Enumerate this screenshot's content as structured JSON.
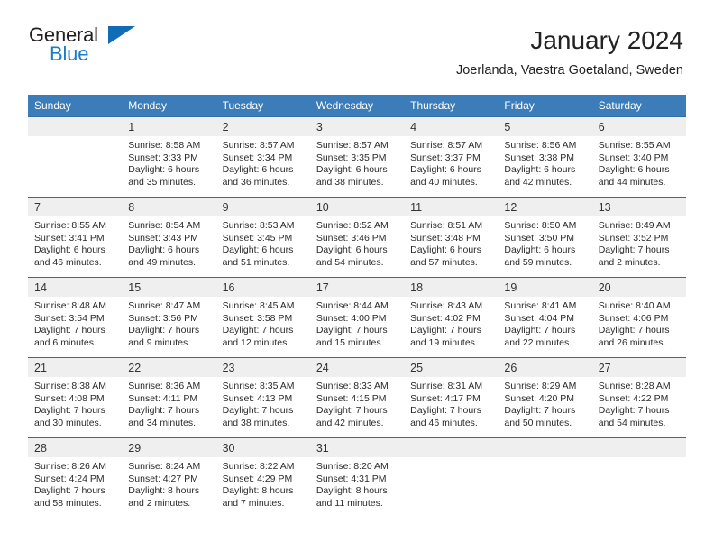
{
  "brand": {
    "name_part1": "General",
    "name_part2": "Blue",
    "accent_color": "#1d7dc4",
    "logo_triangle_color": "#0f6cb5"
  },
  "header": {
    "title": "January 2024",
    "location": "Joerlanda, Vaestra Goetaland, Sweden"
  },
  "calendar": {
    "header_bg": "#3b7cb9",
    "row_border_color": "#2f6da8",
    "daynum_bg": "#efefef",
    "weekday_headers": [
      "Sunday",
      "Monday",
      "Tuesday",
      "Wednesday",
      "Thursday",
      "Friday",
      "Saturday"
    ],
    "weeks": [
      [
        {
          "day": "",
          "lines": []
        },
        {
          "day": "1",
          "lines": [
            "Sunrise: 8:58 AM",
            "Sunset: 3:33 PM",
            "Daylight: 6 hours",
            "and 35 minutes."
          ]
        },
        {
          "day": "2",
          "lines": [
            "Sunrise: 8:57 AM",
            "Sunset: 3:34 PM",
            "Daylight: 6 hours",
            "and 36 minutes."
          ]
        },
        {
          "day": "3",
          "lines": [
            "Sunrise: 8:57 AM",
            "Sunset: 3:35 PM",
            "Daylight: 6 hours",
            "and 38 minutes."
          ]
        },
        {
          "day": "4",
          "lines": [
            "Sunrise: 8:57 AM",
            "Sunset: 3:37 PM",
            "Daylight: 6 hours",
            "and 40 minutes."
          ]
        },
        {
          "day": "5",
          "lines": [
            "Sunrise: 8:56 AM",
            "Sunset: 3:38 PM",
            "Daylight: 6 hours",
            "and 42 minutes."
          ]
        },
        {
          "day": "6",
          "lines": [
            "Sunrise: 8:55 AM",
            "Sunset: 3:40 PM",
            "Daylight: 6 hours",
            "and 44 minutes."
          ]
        }
      ],
      [
        {
          "day": "7",
          "lines": [
            "Sunrise: 8:55 AM",
            "Sunset: 3:41 PM",
            "Daylight: 6 hours",
            "and 46 minutes."
          ]
        },
        {
          "day": "8",
          "lines": [
            "Sunrise: 8:54 AM",
            "Sunset: 3:43 PM",
            "Daylight: 6 hours",
            "and 49 minutes."
          ]
        },
        {
          "day": "9",
          "lines": [
            "Sunrise: 8:53 AM",
            "Sunset: 3:45 PM",
            "Daylight: 6 hours",
            "and 51 minutes."
          ]
        },
        {
          "day": "10",
          "lines": [
            "Sunrise: 8:52 AM",
            "Sunset: 3:46 PM",
            "Daylight: 6 hours",
            "and 54 minutes."
          ]
        },
        {
          "day": "11",
          "lines": [
            "Sunrise: 8:51 AM",
            "Sunset: 3:48 PM",
            "Daylight: 6 hours",
            "and 57 minutes."
          ]
        },
        {
          "day": "12",
          "lines": [
            "Sunrise: 8:50 AM",
            "Sunset: 3:50 PM",
            "Daylight: 6 hours",
            "and 59 minutes."
          ]
        },
        {
          "day": "13",
          "lines": [
            "Sunrise: 8:49 AM",
            "Sunset: 3:52 PM",
            "Daylight: 7 hours",
            "and 2 minutes."
          ]
        }
      ],
      [
        {
          "day": "14",
          "lines": [
            "Sunrise: 8:48 AM",
            "Sunset: 3:54 PM",
            "Daylight: 7 hours",
            "and 6 minutes."
          ]
        },
        {
          "day": "15",
          "lines": [
            "Sunrise: 8:47 AM",
            "Sunset: 3:56 PM",
            "Daylight: 7 hours",
            "and 9 minutes."
          ]
        },
        {
          "day": "16",
          "lines": [
            "Sunrise: 8:45 AM",
            "Sunset: 3:58 PM",
            "Daylight: 7 hours",
            "and 12 minutes."
          ]
        },
        {
          "day": "17",
          "lines": [
            "Sunrise: 8:44 AM",
            "Sunset: 4:00 PM",
            "Daylight: 7 hours",
            "and 15 minutes."
          ]
        },
        {
          "day": "18",
          "lines": [
            "Sunrise: 8:43 AM",
            "Sunset: 4:02 PM",
            "Daylight: 7 hours",
            "and 19 minutes."
          ]
        },
        {
          "day": "19",
          "lines": [
            "Sunrise: 8:41 AM",
            "Sunset: 4:04 PM",
            "Daylight: 7 hours",
            "and 22 minutes."
          ]
        },
        {
          "day": "20",
          "lines": [
            "Sunrise: 8:40 AM",
            "Sunset: 4:06 PM",
            "Daylight: 7 hours",
            "and 26 minutes."
          ]
        }
      ],
      [
        {
          "day": "21",
          "lines": [
            "Sunrise: 8:38 AM",
            "Sunset: 4:08 PM",
            "Daylight: 7 hours",
            "and 30 minutes."
          ]
        },
        {
          "day": "22",
          "lines": [
            "Sunrise: 8:36 AM",
            "Sunset: 4:11 PM",
            "Daylight: 7 hours",
            "and 34 minutes."
          ]
        },
        {
          "day": "23",
          "lines": [
            "Sunrise: 8:35 AM",
            "Sunset: 4:13 PM",
            "Daylight: 7 hours",
            "and 38 minutes."
          ]
        },
        {
          "day": "24",
          "lines": [
            "Sunrise: 8:33 AM",
            "Sunset: 4:15 PM",
            "Daylight: 7 hours",
            "and 42 minutes."
          ]
        },
        {
          "day": "25",
          "lines": [
            "Sunrise: 8:31 AM",
            "Sunset: 4:17 PM",
            "Daylight: 7 hours",
            "and 46 minutes."
          ]
        },
        {
          "day": "26",
          "lines": [
            "Sunrise: 8:29 AM",
            "Sunset: 4:20 PM",
            "Daylight: 7 hours",
            "and 50 minutes."
          ]
        },
        {
          "day": "27",
          "lines": [
            "Sunrise: 8:28 AM",
            "Sunset: 4:22 PM",
            "Daylight: 7 hours",
            "and 54 minutes."
          ]
        }
      ],
      [
        {
          "day": "28",
          "lines": [
            "Sunrise: 8:26 AM",
            "Sunset: 4:24 PM",
            "Daylight: 7 hours",
            "and 58 minutes."
          ]
        },
        {
          "day": "29",
          "lines": [
            "Sunrise: 8:24 AM",
            "Sunset: 4:27 PM",
            "Daylight: 8 hours",
            "and 2 minutes."
          ]
        },
        {
          "day": "30",
          "lines": [
            "Sunrise: 8:22 AM",
            "Sunset: 4:29 PM",
            "Daylight: 8 hours",
            "and 7 minutes."
          ]
        },
        {
          "day": "31",
          "lines": [
            "Sunrise: 8:20 AM",
            "Sunset: 4:31 PM",
            "Daylight: 8 hours",
            "and 11 minutes."
          ]
        },
        {
          "day": "",
          "lines": []
        },
        {
          "day": "",
          "lines": []
        },
        {
          "day": "",
          "lines": []
        }
      ]
    ]
  }
}
